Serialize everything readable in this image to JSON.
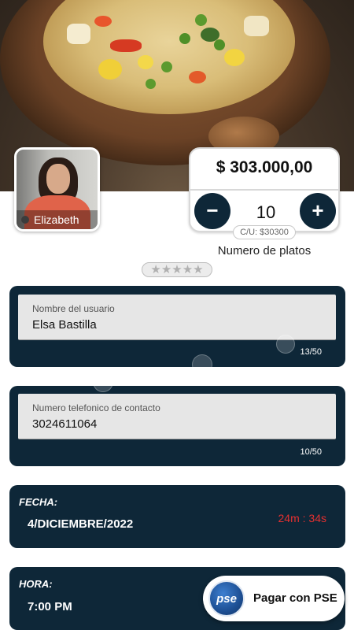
{
  "hero": {
    "image": "bowl-of-vegetable-soup"
  },
  "chef": {
    "name": "Elizabeth"
  },
  "order": {
    "total_price": "$ 303.000,00",
    "minus_label": "−",
    "plus_label": "+",
    "quantity": "10",
    "unit_price": "C/U: $30300",
    "quantity_label": "Numero de platos"
  },
  "rating": {
    "stars": [
      "★",
      "★",
      "★",
      "★",
      "★"
    ],
    "value": 0,
    "max": 5
  },
  "form": {
    "user": {
      "label": "Nombre del usuario",
      "value": "Elsa Bastilla",
      "counter": "13/50"
    },
    "phone": {
      "label": "Numero telefonico de contacto",
      "value": "3024611064",
      "counter": "10/50"
    }
  },
  "date_card": {
    "label": "FECHA:",
    "value": "4/DICIEMBRE/2022",
    "timer": "24m : 34s"
  },
  "time_card": {
    "label": "HORA:",
    "value": "7:00 PM"
  },
  "payment": {
    "logo_text": "pse",
    "label": "Pagar con PSE"
  },
  "colors": {
    "dark_navy": "#0e2738",
    "timer_red": "#e53030"
  }
}
